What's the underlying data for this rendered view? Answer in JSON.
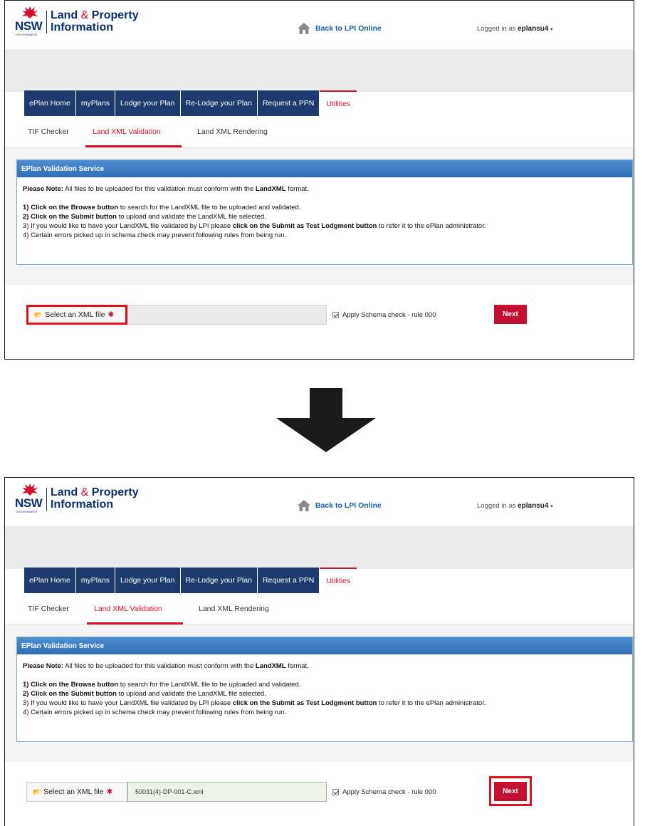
{
  "header": {
    "logo_short": "NSW",
    "logo_gov": "GOVERNMENT",
    "logo_line1_a": "Land",
    "logo_line1_amp": "&",
    "logo_line1_b": "Property",
    "logo_line2": "Information",
    "back_link": "Back to LPI Online",
    "logged_in_prefix": "Logged in as",
    "username": "eplansu4",
    "user_caret": "▾"
  },
  "tabs": [
    "ePlan Home",
    "myPlans",
    "Lodge your Plan",
    "Re-Lodge your Plan",
    "Request a PPN",
    "Utilities"
  ],
  "subtabs": [
    "TIF Checker",
    "Land XML Validation",
    "Land XML Rendering"
  ],
  "panel": {
    "title": "EPlan Validation Service",
    "note_bold": "Please Note:",
    "note_a": " All files to be uploaded for this validation must conform with the ",
    "note_bold2": "LandXML",
    "note_b": " format.",
    "step1_bold": "1) Click on the Browse button",
    "step1_rest": " to search for the LandXML file to be uploaded and validated.",
    "step2_bold": "2) Click on the Submit button",
    "step2_rest": " to upload and validate the LandXML file selected.",
    "step3_a": "3) If you would like to have your LandXML file validated by LPI please ",
    "step3_bold": "click on the Submit as Test Lodgment button",
    "step3_b": " to refer it to the ePlan administrator.",
    "step4": "4) Certain errors picked up in schema check may prevent following rules from being run."
  },
  "form": {
    "select_label": "Select an XML file",
    "required_mark": "✱",
    "folder_icon": "📂",
    "file_empty": "",
    "file_selected": "50031(4)-DP-001-C.xml",
    "schema_check_label": "Apply Schema check - rule 000",
    "next_label": "Next"
  },
  "colors": {
    "nav_blue": "#1f3a6e",
    "accent_red": "#d4112b",
    "panel_blue": "#2f6db4",
    "highlight_red": "#e0101e"
  }
}
